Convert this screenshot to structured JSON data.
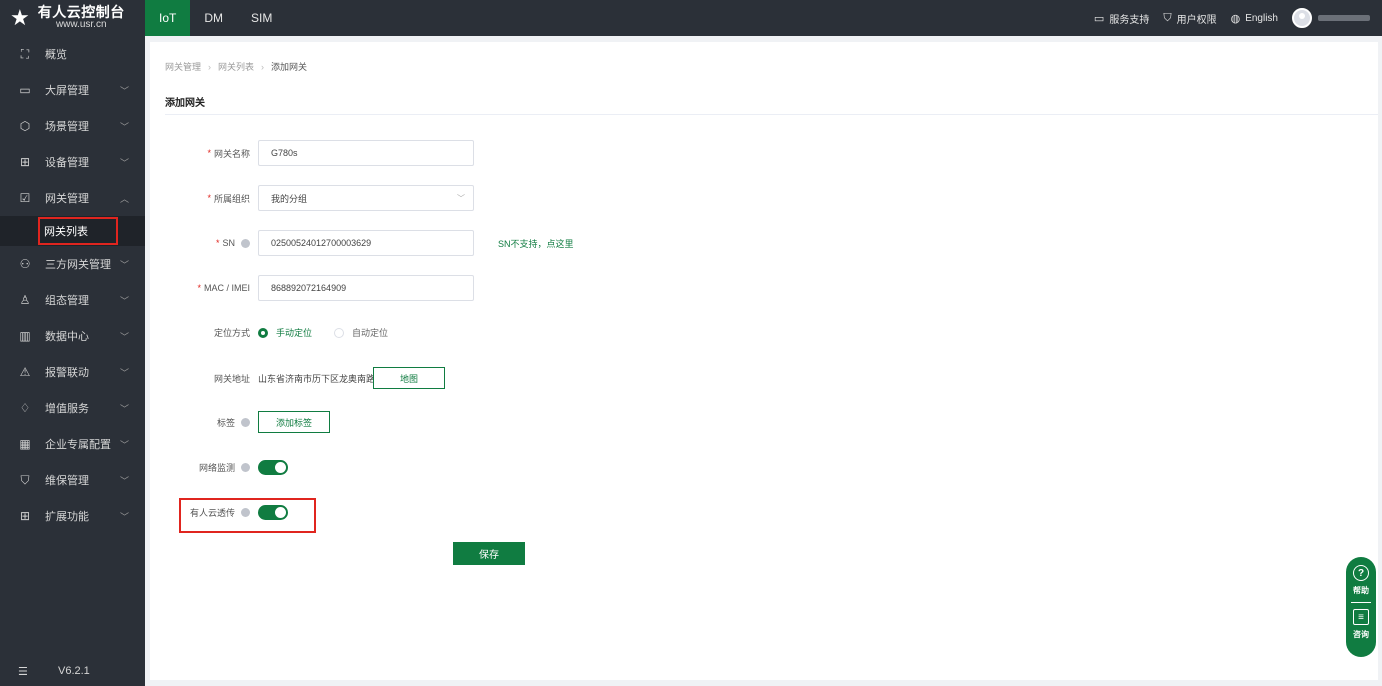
{
  "app": {
    "logo_name": "有人云控制台",
    "logo_url": "www.usr.cn",
    "logo_mark": "★"
  },
  "top_tabs": [
    {
      "label": "IoT",
      "active": true
    },
    {
      "label": "DM",
      "active": false
    },
    {
      "label": "SIM",
      "active": false
    }
  ],
  "top_right": {
    "service": "服务支持",
    "permissions": "用户权限",
    "language": "English"
  },
  "sidebar": {
    "items": [
      {
        "label": "概览",
        "icon": "overview-icon",
        "glyph": "⛶"
      },
      {
        "label": "大屏管理",
        "icon": "screen-icon",
        "glyph": "▭"
      },
      {
        "label": "场景管理",
        "icon": "scene-icon",
        "glyph": "⬡"
      },
      {
        "label": "设备管理",
        "icon": "device-icon",
        "glyph": "⊞"
      },
      {
        "label": "网关管理",
        "icon": "gateway-icon",
        "glyph": "☑"
      },
      {
        "label": "三方网关管理",
        "icon": "third-party-icon",
        "glyph": "⚇"
      },
      {
        "label": "组态管理",
        "icon": "config-icon",
        "glyph": "♙"
      },
      {
        "label": "数据中心",
        "icon": "data-icon",
        "glyph": "▥"
      },
      {
        "label": "报警联动",
        "icon": "alarm-icon",
        "glyph": "⚠"
      },
      {
        "label": "增值服务",
        "icon": "vas-icon",
        "glyph": "♢"
      },
      {
        "label": "企业专属配置",
        "icon": "enterprise-icon",
        "glyph": "▦"
      },
      {
        "label": "维保管理",
        "icon": "maintenance-icon",
        "glyph": "⛉"
      },
      {
        "label": "扩展功能",
        "icon": "extend-icon",
        "glyph": "⊞"
      }
    ],
    "active_sub": "网关列表",
    "version": "V6.2.1"
  },
  "breadcrumb": [
    "网关管理",
    "网关列表",
    "添加网关"
  ],
  "page_title": "添加网关",
  "form": {
    "name_label": "网关名称",
    "name_value": "G780s",
    "org_label": "所属组织",
    "org_value": "我的分组",
    "sn_label": "SN",
    "sn_value": "02500524012700003629",
    "sn_link": "SN不支持，点这里",
    "mac_label": "MAC / IMEI",
    "mac_value": "868892072164909",
    "locate_label": "定位方式",
    "locate_manual": "手动定位",
    "locate_auto": "自动定位",
    "address_label": "网关地址",
    "address_value": "山东省济南市历下区龙奥南路",
    "map_button": "地图",
    "tag_label": "标签",
    "tag_button": "添加标签",
    "monitor_label": "网络监测",
    "monitor_on": true,
    "passthrough_label": "有人云透传",
    "passthrough_on": true,
    "save": "保存"
  },
  "float_help": {
    "help": "帮助",
    "consult": "咨询"
  },
  "colors": {
    "brand": "#107c41",
    "highlight": "#e0251f",
    "sidebar": "#2b3038"
  }
}
